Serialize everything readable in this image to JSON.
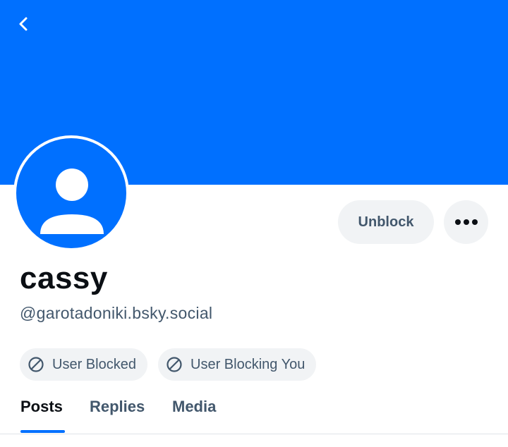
{
  "profile": {
    "display_name": "cassy",
    "handle": "@garotadoniki.bsky.social",
    "avatar_icon": "default-avatar-icon",
    "banner_color": "#0070ff"
  },
  "header": {
    "back_icon": "chevron-left-icon"
  },
  "actions": {
    "unblock_label": "Unblock",
    "more_icon": "ellipsis-icon"
  },
  "badges": [
    {
      "label": "User Blocked",
      "icon": "block-icon"
    },
    {
      "label": "User Blocking You",
      "icon": "block-icon"
    }
  ],
  "tabs": [
    {
      "label": "Posts",
      "active": true
    },
    {
      "label": "Replies",
      "active": false
    },
    {
      "label": "Media",
      "active": false
    }
  ],
  "colors": {
    "accent": "#0070ff",
    "text_primary": "#0b0f14",
    "text_secondary": "#42576c",
    "pill_bg": "#f1f3f5"
  }
}
